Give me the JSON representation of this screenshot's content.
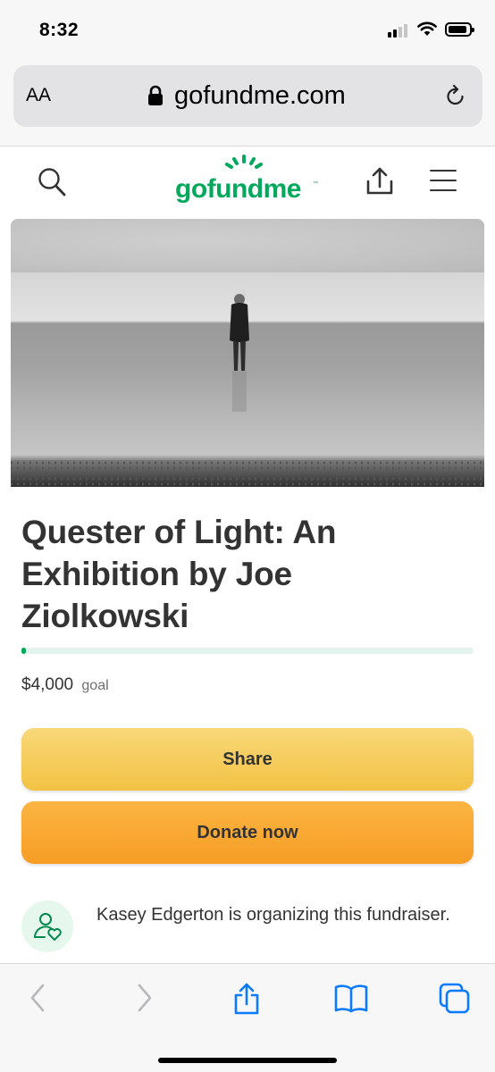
{
  "status_bar": {
    "time": "8:32"
  },
  "browser": {
    "text_size_label": "AA",
    "url": "gofundme.com"
  },
  "site": {
    "logo": "gofundme"
  },
  "campaign": {
    "title": "Quester of Light: An Exhibition by Joe Ziolkowski",
    "amount": "$4,000",
    "goal_label": "goal",
    "progress": 0.01,
    "share_label": "Share",
    "donate_label": "Donate now",
    "organizer_text": "Kasey Edgerton is organizing this fundraiser."
  },
  "colors": {
    "brand_green": "#02a95c",
    "share_button": "#f3c244",
    "donate_button": "#f79d25",
    "ios_blue": "#0a7aff"
  },
  "icons": {
    "browser_toolbar": [
      "back-icon",
      "forward-icon",
      "share-icon",
      "bookmarks-icon",
      "tabs-icon"
    ],
    "site_header": [
      "search-icon",
      "share-icon",
      "menu-icon"
    ]
  }
}
